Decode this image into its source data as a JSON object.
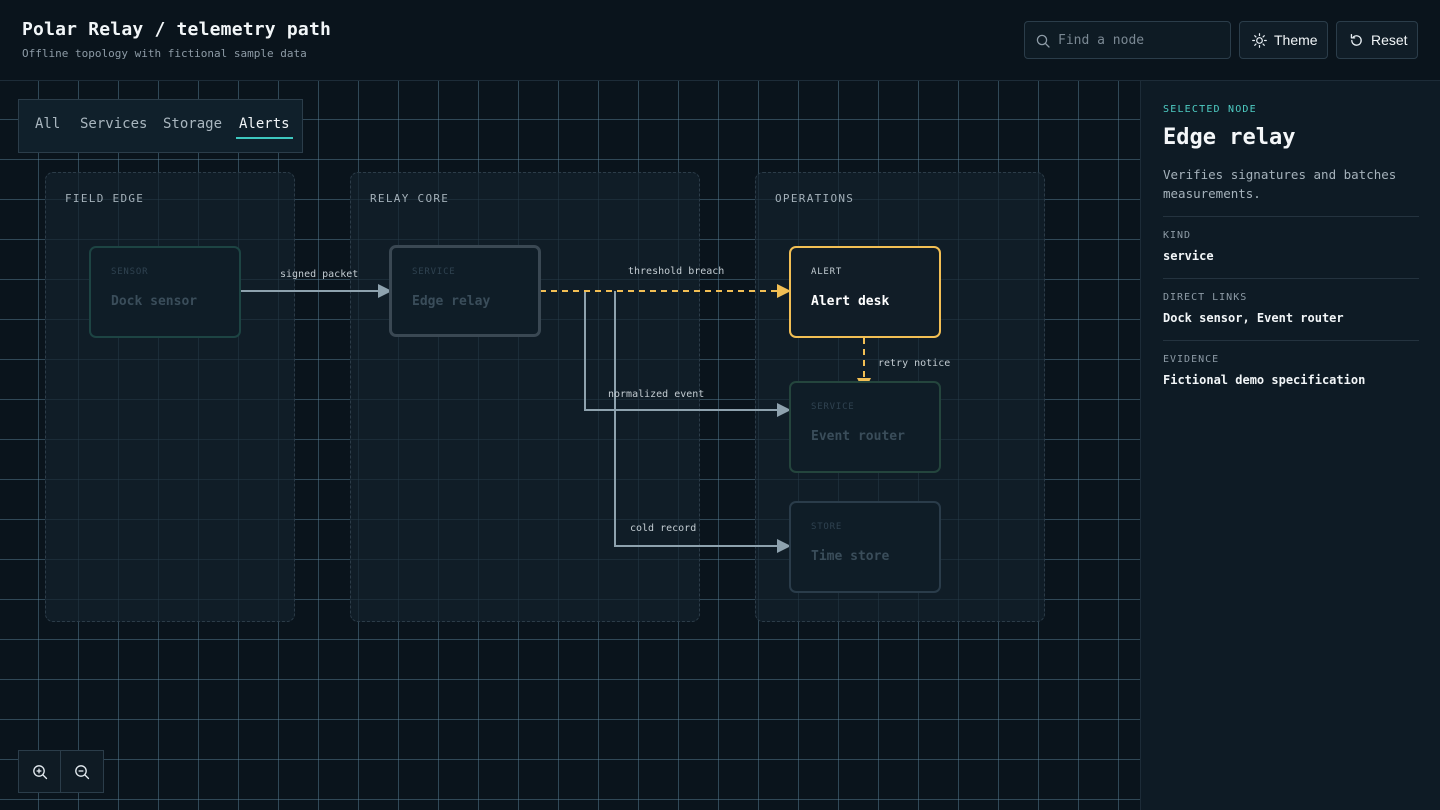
{
  "header": {
    "title": "Polar Relay / telemetry path",
    "subtitle": "Offline topology with fictional sample data",
    "search_placeholder": "Find a node",
    "theme_label": "Theme",
    "reset_label": "Reset"
  },
  "filters": [
    {
      "label": "All",
      "active": false
    },
    {
      "label": "Services",
      "active": false
    },
    {
      "label": "Storage",
      "active": false
    },
    {
      "label": "Alerts",
      "active": true
    }
  ],
  "groups": [
    {
      "label": "FIELD EDGE"
    },
    {
      "label": "RELAY CORE"
    },
    {
      "label": "OPERATIONS"
    }
  ],
  "nodes": {
    "dock_sensor": {
      "kind": "SENSOR",
      "name": "Dock sensor"
    },
    "edge_relay": {
      "kind": "SERVICE",
      "name": "Edge relay"
    },
    "alert_desk": {
      "kind": "ALERT",
      "name": "Alert desk"
    },
    "event_router": {
      "kind": "SERVICE",
      "name": "Event router"
    },
    "time_store": {
      "kind": "STORE",
      "name": "Time store"
    }
  },
  "edges": [
    {
      "label": "signed packet",
      "from": "Dock sensor",
      "to": "Edge relay"
    },
    {
      "label": "threshold breach",
      "from": "Edge relay",
      "to": "Alert desk",
      "highlighted": true
    },
    {
      "label": "normalized event",
      "from": "Edge relay",
      "to": "Event router"
    },
    {
      "label": "cold record",
      "from": "Edge relay",
      "to": "Time store"
    },
    {
      "label": "retry notice",
      "from": "Alert desk",
      "to": "Event router",
      "highlighted": true
    }
  ],
  "sidebar": {
    "eyebrow": "SELECTED NODE",
    "title": "Edge relay",
    "description": "Verifies signatures and batches measurements.",
    "fields": [
      {
        "key": "KIND",
        "value": "service"
      },
      {
        "key": "DIRECT LINKS",
        "value": "Dock sensor, Event router"
      },
      {
        "key": "EVIDENCE",
        "value": "Fictional demo specification"
      }
    ]
  },
  "colors": {
    "accent": "#4ecdc4",
    "highlight": "#f2bf54",
    "edge": "#8ea2ae",
    "background": "#0a141c"
  },
  "icons": [
    "search-icon",
    "sun-icon",
    "reset-icon",
    "zoom-in-icon",
    "zoom-out-icon"
  ]
}
